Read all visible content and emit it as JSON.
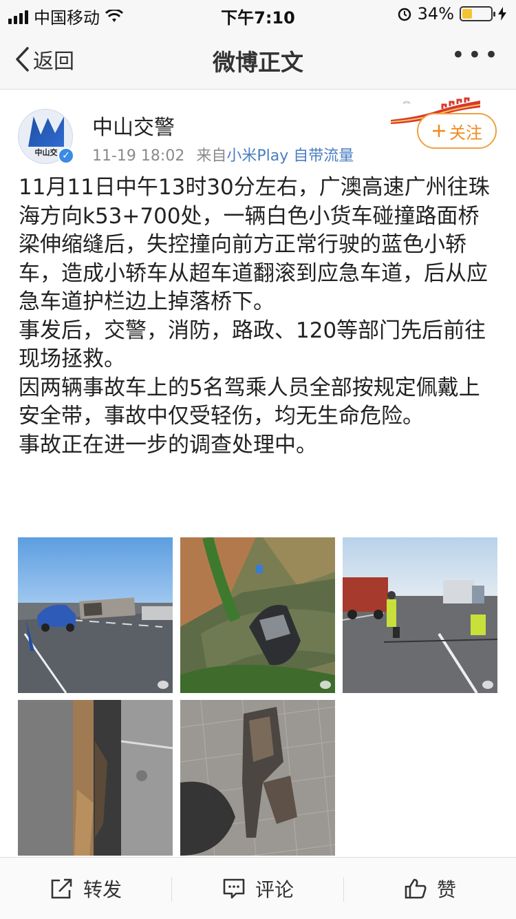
{
  "status_bar": {
    "carrier": "中国移动",
    "time": "下午7:10",
    "battery_text": "34%",
    "battery_level": 0.34
  },
  "nav": {
    "back_label": "返回",
    "title": "微博正文",
    "more_label": "•••"
  },
  "post": {
    "avatar_text": "中山交",
    "author": "中山交警",
    "time": "11-19 18:02",
    "source_prefix": "来自",
    "source": "小米Play 自带流量",
    "follow_label": "关注",
    "paragraphs": [
      "11月11日中午13时30分左右，广澳高速广州往珠海方向k53+700处，一辆白色小货车碰撞路面桥梁伸缩缝后，失控撞向前方正常行驶的蓝色小轿车，造成小轿车从超车道翻滚到应急车道，后从应急车道护栏边上掉落桥下。",
      "事发后，交警，消防，路政、120等部门先后前往现场拯救。",
      "因两辆事故车上的5名驾乘人员全部按规定佩戴上安全带，事故中仅受轻伤，均无生命危险。",
      "事故正在进一步的调查处理中。"
    ]
  },
  "actions": {
    "repost_label": "转发",
    "comment_label": "评论",
    "like_label": "赞"
  },
  "colors": {
    "accent_orange": "#f08a1e",
    "link_blue": "#4a7ec2",
    "verified_blue": "#3b8be6"
  }
}
